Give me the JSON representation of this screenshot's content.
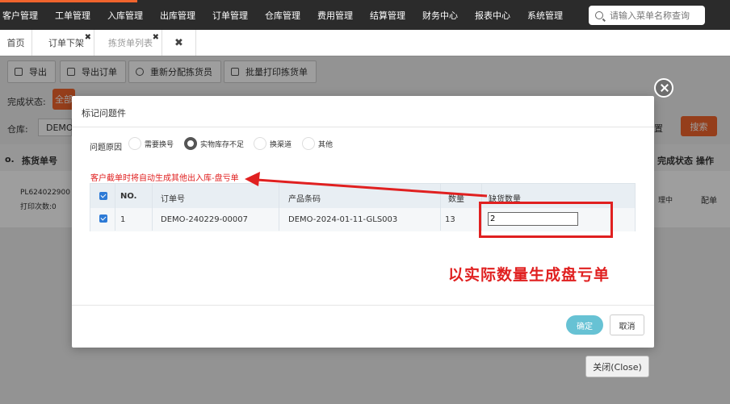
{
  "nav": {
    "items": [
      "客户管理",
      "工单管理",
      "入库管理",
      "出库管理",
      "订单管理",
      "仓库管理",
      "费用管理",
      "结算管理",
      "财务中心",
      "报表中心",
      "系统管理"
    ],
    "search_placeholder": "请输入菜单名称查询"
  },
  "tabs": [
    {
      "label": "首页"
    },
    {
      "label": "订单下架"
    },
    {
      "label": "拣货单列表"
    }
  ],
  "toolbar": {
    "export": "导出",
    "export_order": "导出订单",
    "reassign": "重新分配拣货员",
    "batch_print": "批量打印拣货单"
  },
  "background": {
    "status_label": "完成状态:",
    "status_all": "全部",
    "warehouse_label": "仓库:",
    "warehouse_value": "DEMO",
    "search_btn": "搜索",
    "col_pick_no": "拣货单号",
    "col_status": "完成状态",
    "col_ops": "操作",
    "row_pick_no": "PL624022900",
    "row_print_count": "打印次数:0",
    "row_status": "理中",
    "row_op": "配单",
    "close_btn": "关闭(Close)"
  },
  "modal": {
    "title": "标记问题件",
    "reason_label": "问题原因",
    "reasons": [
      {
        "label": "需要换号",
        "selected": false
      },
      {
        "label": "实物库存不足",
        "selected": true
      },
      {
        "label": "换渠道",
        "selected": false
      },
      {
        "label": "其他",
        "selected": false
      }
    ],
    "note": "客户截单时将自动生成其他出入库-盘亏单",
    "table": {
      "headers": [
        "NO.",
        "订单号",
        "产品条码",
        "数量",
        "缺货数量"
      ],
      "rows": [
        {
          "no": "1",
          "order_no": "DEMO-240229-00007",
          "barcode": "DEMO-2024-01-11-GLS003",
          "qty": "13",
          "short_qty": "2"
        }
      ]
    },
    "ok_label": "确定",
    "cancel_label": "取消"
  },
  "annotation": {
    "text": "以实际数量生成盘亏单",
    "color": "#e02020"
  }
}
